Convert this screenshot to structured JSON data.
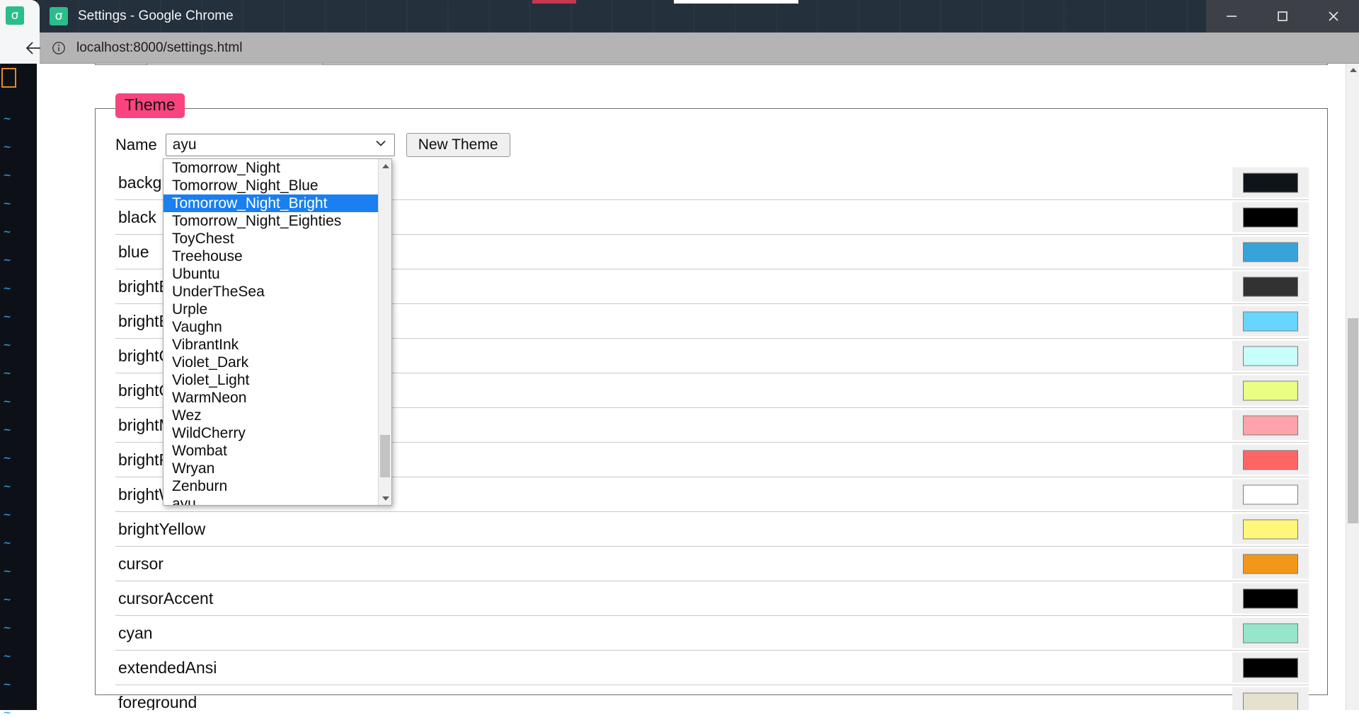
{
  "window": {
    "title": "Settings - Google Chrome",
    "favicon_glyph": "σ",
    "minimize_label": "Minimize",
    "maximize_label": "Maximize",
    "close_label": "Close"
  },
  "toolbar": {
    "back_label": "Back",
    "url": "localhost:8000/settings.html",
    "info_glyph": "i"
  },
  "theme_panel": {
    "legend": "Theme",
    "legend_bg": "#f9447f",
    "name_label": "Name",
    "selected_theme": "ayu",
    "new_theme_button": "New Theme"
  },
  "dropdown": {
    "highlighted": "Tomorrow_Night_Bright",
    "highlight_color": "#1a7ff0",
    "options": [
      "Tomorrow_Night",
      "Tomorrow_Night_Blue",
      "Tomorrow_Night_Bright",
      "Tomorrow_Night_Eighties",
      "ToyChest",
      "Treehouse",
      "Ubuntu",
      "UnderTheSea",
      "Urple",
      "Vaughn",
      "VibrantInk",
      "Violet_Dark",
      "Violet_Light",
      "WarmNeon",
      "Wez",
      "WildCherry",
      "Wombat",
      "Wryan",
      "Zenburn",
      "ayu"
    ]
  },
  "color_rows": [
    {
      "name": "background",
      "color": "#0f1419"
    },
    {
      "name": "black",
      "color": "#000000"
    },
    {
      "name": "blue",
      "color": "#36a3d9"
    },
    {
      "name": "brightBlack",
      "color": "#323232"
    },
    {
      "name": "brightBlue",
      "color": "#68d5ff"
    },
    {
      "name": "brightCyan",
      "color": "#c7fffd"
    },
    {
      "name": "brightGreen",
      "color": "#eafe84"
    },
    {
      "name": "brightMagenta",
      "color": "#ffa3aa"
    },
    {
      "name": "brightRed",
      "color": "#ff6565"
    },
    {
      "name": "brightWhite",
      "color": "#ffffff"
    },
    {
      "name": "brightYellow",
      "color": "#fff779"
    },
    {
      "name": "cursor",
      "color": "#f29718"
    },
    {
      "name": "cursorAccent",
      "color": "#000000"
    },
    {
      "name": "cyan",
      "color": "#95e6cb"
    },
    {
      "name": "extendedAnsi",
      "color": "#000000"
    },
    {
      "name": "foreground",
      "color": "#e6e1cf"
    }
  ],
  "terminal": {
    "tilde": "~",
    "tilde_color": "#2f9fe8",
    "background": "#0d1117",
    "cursor_color": "#e08c28"
  }
}
